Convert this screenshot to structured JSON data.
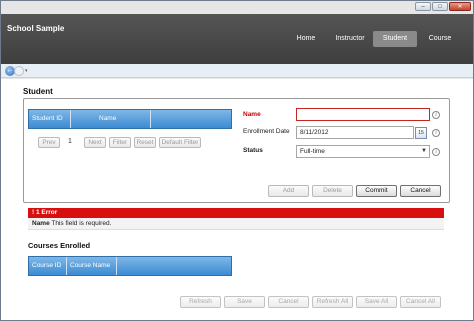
{
  "window": {
    "controls": [
      "–",
      "□",
      "✕"
    ]
  },
  "app": {
    "title": "School Sample"
  },
  "nav": [
    {
      "label": "Home",
      "active": false
    },
    {
      "label": "Instructor",
      "active": false
    },
    {
      "label": "Student",
      "active": true
    },
    {
      "label": "Course",
      "active": false
    }
  ],
  "browser": {
    "back_glyph": "←",
    "dropdown_glyph": "▾"
  },
  "student": {
    "title": "Student",
    "grid": {
      "columns": [
        "Student ID",
        "Name"
      ]
    },
    "pager": {
      "prev": "Prev",
      "page": "1",
      "next": "Next",
      "filter": "Filter",
      "reset": "Reset",
      "default_filter": "Default Filter"
    },
    "form": {
      "name_label": "Name",
      "name_value": "",
      "enrollment_label": "Enrollment Date",
      "enrollment_value": "8/11/2012",
      "calendar_glyph": "15",
      "status_label": "Status",
      "status_value": "Full-time",
      "info_glyph": "i"
    },
    "actions": {
      "add": "Add",
      "delete": "Delete",
      "commit": "Commit",
      "cancel": "Cancel"
    },
    "error": {
      "header": "! 1 Error",
      "field": "Name",
      "message": " This field is required."
    }
  },
  "courses": {
    "title": "Courses Enrolled",
    "columns": [
      "Course ID",
      "Course Name"
    ]
  },
  "bottom": {
    "refresh": "Refresh",
    "save": "Save",
    "cancel": "Cancel",
    "refresh_all": "Refresh All",
    "save_all": "Save All",
    "cancel_all": "Cancel All"
  },
  "colors": {
    "header_bg": "#474747",
    "grid_header": "#4a95d8",
    "error_red": "#d80f0f",
    "required_red": "#c00000"
  }
}
